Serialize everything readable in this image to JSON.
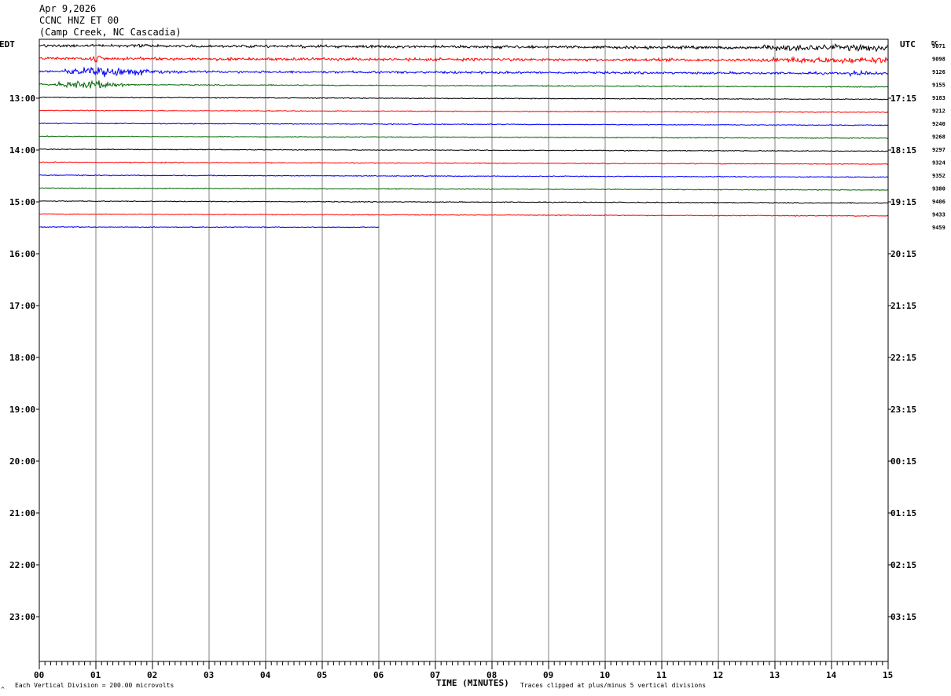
{
  "header": {
    "date": "Apr 9,2026",
    "station": "CCNC HNZ ET 00",
    "location": "(Camp Creek, NC Cascadia)"
  },
  "left_timezone": "EDT",
  "right_timezone": "UTC",
  "dc_label": "DC",
  "footer": {
    "scale_note": "Each Vertical Division =  200.00 microvolts",
    "xlabel": "TIME (MINUTES)",
    "clip_note": "Traces clipped at plus/minus 5 vertical divisions",
    "corner_mark": "^"
  },
  "chart_data": {
    "type": "line",
    "title": "CCNC HNZ ET 00",
    "xlabel": "TIME (MINUTES)",
    "x_range": [
      0,
      15
    ],
    "x_ticks": [
      "00",
      "01",
      "02",
      "03",
      "04",
      "05",
      "06",
      "07",
      "08",
      "09",
      "10",
      "11",
      "12",
      "13",
      "14",
      "15"
    ],
    "rows_per_hour": 4,
    "left_hour_labels": [
      "13:00",
      "14:00",
      "15:00",
      "16:00",
      "17:00",
      "18:00",
      "19:00",
      "20:00",
      "21:00",
      "22:00",
      "23:00"
    ],
    "right_hour_labels": [
      "17:15",
      "18:15",
      "19:15",
      "20:15",
      "21:15",
      "22:15",
      "23:15",
      "00:15",
      "01:15",
      "02:15",
      "03:15"
    ],
    "total_rows": 48,
    "trace_colors": [
      "#000000",
      "#ff0000",
      "#0000ff",
      "#006400"
    ],
    "traces": [
      {
        "row": 0,
        "dc": "9071",
        "color": "#000000",
        "end_minute": 15,
        "activity": "moderate-noise",
        "drift_divisions": 0.4
      },
      {
        "row": 1,
        "dc": "9098",
        "color": "#ff0000",
        "end_minute": 15,
        "activity": "moderate-noise",
        "drift_divisions": 0.3
      },
      {
        "row": 2,
        "dc": "9126",
        "color": "#0000ff",
        "end_minute": 15,
        "activity": "event-start-0.5-2.5min",
        "drift_divisions": 0.3
      },
      {
        "row": 3,
        "dc": "9155",
        "color": "#006400",
        "end_minute": 15,
        "activity": "event-start-0-1.5min",
        "drift_divisions": 0.4
      },
      {
        "row": 4,
        "dc": "9183",
        "color": "#000000",
        "end_minute": 15,
        "activity": "quiet",
        "drift_divisions": 0.3
      },
      {
        "row": 5,
        "dc": "9212",
        "color": "#ff0000",
        "end_minute": 15,
        "activity": "quiet",
        "drift_divisions": 0.3
      },
      {
        "row": 6,
        "dc": "9240",
        "color": "#0000ff",
        "end_minute": 15,
        "activity": "quiet",
        "drift_divisions": 0.3
      },
      {
        "row": 7,
        "dc": "9268",
        "color": "#006400",
        "end_minute": 15,
        "activity": "quiet",
        "drift_divisions": 0.3
      },
      {
        "row": 8,
        "dc": "9297",
        "color": "#000000",
        "end_minute": 15,
        "activity": "quiet",
        "drift_divisions": 0.3
      },
      {
        "row": 9,
        "dc": "9324",
        "color": "#ff0000",
        "end_minute": 15,
        "activity": "quiet",
        "drift_divisions": 0.3
      },
      {
        "row": 10,
        "dc": "9352",
        "color": "#0000ff",
        "end_minute": 15,
        "activity": "quiet",
        "drift_divisions": 0.3
      },
      {
        "row": 11,
        "dc": "9380",
        "color": "#006400",
        "end_minute": 15,
        "activity": "quiet",
        "drift_divisions": 0.3
      },
      {
        "row": 12,
        "dc": "9406",
        "color": "#000000",
        "end_minute": 15,
        "activity": "quiet",
        "drift_divisions": 0.3
      },
      {
        "row": 13,
        "dc": "9433",
        "color": "#ff0000",
        "end_minute": 15,
        "activity": "quiet",
        "drift_divisions": 0.3
      },
      {
        "row": 14,
        "dc": "9459",
        "color": "#0000ff",
        "end_minute": 6,
        "activity": "quiet",
        "drift_divisions": 0.1
      }
    ],
    "grid": true
  }
}
